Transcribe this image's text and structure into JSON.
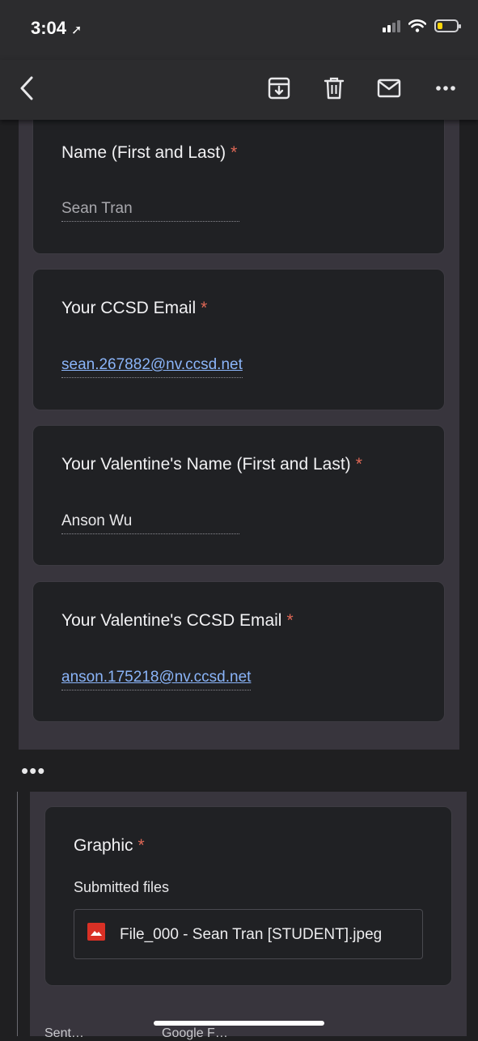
{
  "status_bar": {
    "time": "3:04",
    "battery_level": 0.25,
    "battery_color": "#ffd60a"
  },
  "toolbar": {
    "back_icon": "chevron-left-icon",
    "archive_icon": "archive-icon",
    "trash_icon": "trash-icon",
    "mail_icon": "mail-icon",
    "more_icon": "more-horizontal-icon"
  },
  "form": {
    "questions": [
      {
        "title": "Name (First and Last)",
        "required_mark": "*",
        "answer": "Sean Tran"
      },
      {
        "title": "Your CCSD Email",
        "required_mark": "*",
        "answer": "sean.267882@nv.ccsd.net"
      },
      {
        "title": "Your Valentine's Name (First and Last)",
        "required_mark": "*",
        "answer": "Anson Wu"
      },
      {
        "title": "Your Valentine's CCSD Email",
        "required_mark": "*",
        "answer": "anson.175218@nv.ccsd.net"
      }
    ]
  },
  "trimmed_content": {
    "label": "•••"
  },
  "graphic": {
    "title": "Graphic",
    "required_mark": "*",
    "submitted_label": "Submitted files",
    "file_name": "File_000 - Sean Tran [STUDENT].jpeg",
    "file_icon": "image-file-icon"
  },
  "footer": {
    "left_text": "Sent…",
    "right_text": "Google F…"
  },
  "colors": {
    "accent_link": "#8ab4f8",
    "required": "#e06856",
    "panel": "#38353d",
    "card": "#202124"
  }
}
